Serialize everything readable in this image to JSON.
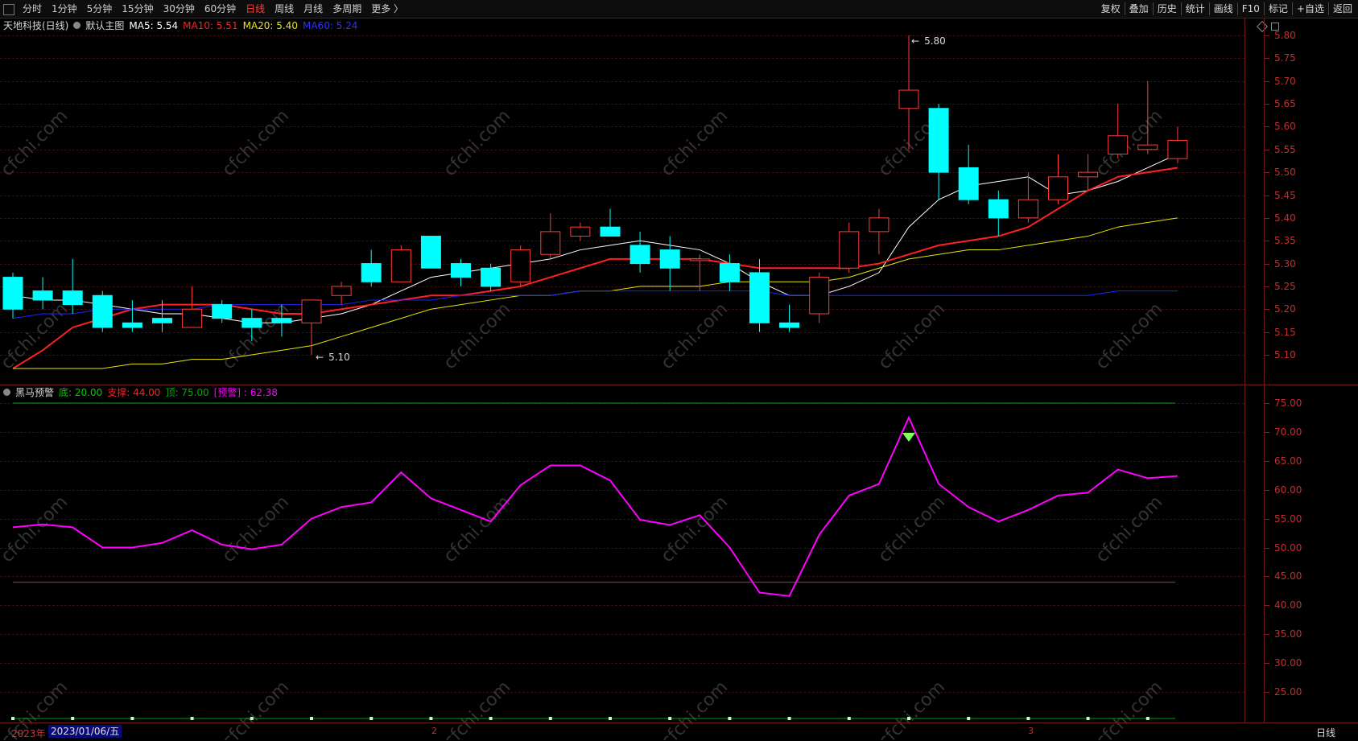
{
  "toolbar": {
    "periods": [
      "分时",
      "1分钟",
      "5分钟",
      "15分钟",
      "30分钟",
      "60分钟",
      "日线",
      "周线",
      "月线",
      "多周期",
      "更多 〉"
    ],
    "active_period": "日线",
    "tools": [
      "复权",
      "叠加",
      "历史",
      "统计",
      "画线",
      "F10",
      "标记",
      "+自选",
      "返回"
    ]
  },
  "main_legend": {
    "stock": "天地科技(日线)",
    "chart_name": "默认主图",
    "ma5": "MA5: 5.54",
    "ma10": "MA10: 5.51",
    "ma20": "MA20: 5.40",
    "ma60": "MA60: 5.24"
  },
  "sub_legend": {
    "name": "黑马预警",
    "bottom": "底: 20.00",
    "support": "支撑: 44.00",
    "top": "顶: 75.00",
    "warn": "[预警] : 62.38"
  },
  "colors": {
    "up": "#ff3b3b",
    "down": "#00ffff",
    "ma5": "#ffffff",
    "ma10": "#ff2020",
    "ma20": "#e8e800",
    "ma60": "#2020ff",
    "indicator": "#ff00ff"
  },
  "chart_data": [
    {
      "type": "candlestick",
      "title": "天地科技(日线)",
      "y_ticks": [
        "5.80",
        "5.75",
        "5.70",
        "5.65",
        "5.60",
        "5.55",
        "5.50",
        "5.45",
        "5.40",
        "5.35",
        "5.30",
        "5.25",
        "5.20",
        "5.15",
        "5.10"
      ],
      "ylim": [
        5.05,
        5.82
      ],
      "annotations": {
        "high": "5.80",
        "low": "5.10"
      },
      "candles": [
        {
          "o": 5.27,
          "h": 5.28,
          "l": 5.18,
          "c": 5.2
        },
        {
          "o": 5.24,
          "h": 5.27,
          "l": 5.2,
          "c": 5.22
        },
        {
          "o": 5.24,
          "h": 5.31,
          "l": 5.19,
          "c": 5.21
        },
        {
          "o": 5.23,
          "h": 5.24,
          "l": 5.15,
          "c": 5.16
        },
        {
          "o": 5.17,
          "h": 5.22,
          "l": 5.15,
          "c": 5.16
        },
        {
          "o": 5.18,
          "h": 5.22,
          "l": 5.15,
          "c": 5.17
        },
        {
          "o": 5.16,
          "h": 5.25,
          "l": 5.16,
          "c": 5.2
        },
        {
          "o": 5.21,
          "h": 5.22,
          "l": 5.17,
          "c": 5.18
        },
        {
          "o": 5.18,
          "h": 5.2,
          "l": 5.13,
          "c": 5.16
        },
        {
          "o": 5.18,
          "h": 5.21,
          "l": 5.14,
          "c": 5.17
        },
        {
          "o": 5.17,
          "h": 5.22,
          "l": 5.1,
          "c": 5.22
        },
        {
          "o": 5.23,
          "h": 5.26,
          "l": 5.21,
          "c": 5.25
        },
        {
          "o": 5.3,
          "h": 5.33,
          "l": 5.25,
          "c": 5.26
        },
        {
          "o": 5.26,
          "h": 5.34,
          "l": 5.26,
          "c": 5.33
        },
        {
          "o": 5.36,
          "h": 5.36,
          "l": 5.29,
          "c": 5.29
        },
        {
          "o": 5.3,
          "h": 5.31,
          "l": 5.25,
          "c": 5.27
        },
        {
          "o": 5.29,
          "h": 5.3,
          "l": 5.24,
          "c": 5.25
        },
        {
          "o": 5.26,
          "h": 5.34,
          "l": 5.25,
          "c": 5.33
        },
        {
          "o": 5.32,
          "h": 5.41,
          "l": 5.31,
          "c": 5.37
        },
        {
          "o": 5.36,
          "h": 5.39,
          "l": 5.35,
          "c": 5.38
        },
        {
          "o": 5.38,
          "h": 5.42,
          "l": 5.36,
          "c": 5.36
        },
        {
          "o": 5.34,
          "h": 5.37,
          "l": 5.28,
          "c": 5.3
        },
        {
          "o": 5.33,
          "h": 5.36,
          "l": 5.24,
          "c": 5.29
        },
        {
          "o": 5.31,
          "h": 5.32,
          "l": 5.24,
          "c": 5.31
        },
        {
          "o": 5.3,
          "h": 5.32,
          "l": 5.24,
          "c": 5.26
        },
        {
          "o": 5.28,
          "h": 5.31,
          "l": 5.15,
          "c": 5.17
        },
        {
          "o": 5.17,
          "h": 5.21,
          "l": 5.15,
          "c": 5.16
        },
        {
          "o": 5.19,
          "h": 5.28,
          "l": 5.17,
          "c": 5.27
        },
        {
          "o": 5.29,
          "h": 5.39,
          "l": 5.28,
          "c": 5.37
        },
        {
          "o": 5.37,
          "h": 5.42,
          "l": 5.32,
          "c": 5.4
        },
        {
          "o": 5.64,
          "h": 5.8,
          "l": 5.55,
          "c": 5.68
        },
        {
          "o": 5.64,
          "h": 5.65,
          "l": 5.44,
          "c": 5.5
        },
        {
          "o": 5.51,
          "h": 5.56,
          "l": 5.43,
          "c": 5.44
        },
        {
          "o": 5.44,
          "h": 5.46,
          "l": 5.36,
          "c": 5.4
        },
        {
          "o": 5.4,
          "h": 5.5,
          "l": 5.39,
          "c": 5.44
        },
        {
          "o": 5.44,
          "h": 5.54,
          "l": 5.43,
          "c": 5.49
        },
        {
          "o": 5.49,
          "h": 5.54,
          "l": 5.46,
          "c": 5.5
        },
        {
          "o": 5.54,
          "h": 5.65,
          "l": 5.53,
          "c": 5.58
        },
        {
          "o": 5.55,
          "h": 5.7,
          "l": 5.54,
          "c": 5.56
        },
        {
          "o": 5.53,
          "h": 5.6,
          "l": 5.52,
          "c": 5.57
        }
      ],
      "series": [
        {
          "name": "MA5",
          "values": [
            5.23,
            5.22,
            5.22,
            5.21,
            5.2,
            5.19,
            5.19,
            5.18,
            5.17,
            5.17,
            5.18,
            5.19,
            5.21,
            5.24,
            5.27,
            5.28,
            5.29,
            5.3,
            5.31,
            5.33,
            5.34,
            5.35,
            5.34,
            5.33,
            5.3,
            5.26,
            5.23,
            5.23,
            5.25,
            5.28,
            5.38,
            5.44,
            5.47,
            5.48,
            5.49,
            5.45,
            5.46,
            5.48,
            5.51,
            5.54
          ]
        },
        {
          "name": "MA10",
          "values": [
            5.07,
            5.11,
            5.16,
            5.18,
            5.2,
            5.21,
            5.21,
            5.21,
            5.2,
            5.19,
            5.19,
            5.2,
            5.21,
            5.22,
            5.23,
            5.23,
            5.24,
            5.25,
            5.27,
            5.29,
            5.31,
            5.31,
            5.31,
            5.31,
            5.3,
            5.29,
            5.29,
            5.29,
            5.29,
            5.3,
            5.32,
            5.34,
            5.35,
            5.36,
            5.38,
            5.42,
            5.46,
            5.49,
            5.5,
            5.51
          ]
        },
        {
          "name": "MA20",
          "values": [
            5.07,
            5.07,
            5.07,
            5.07,
            5.08,
            5.08,
            5.09,
            5.09,
            5.1,
            5.11,
            5.12,
            5.14,
            5.16,
            5.18,
            5.2,
            5.21,
            5.22,
            5.23,
            5.23,
            5.24,
            5.24,
            5.25,
            5.25,
            5.25,
            5.26,
            5.26,
            5.26,
            5.26,
            5.27,
            5.29,
            5.31,
            5.32,
            5.33,
            5.33,
            5.34,
            5.35,
            5.36,
            5.38,
            5.39,
            5.4
          ]
        },
        {
          "name": "MA60",
          "values": [
            5.18,
            5.19,
            5.19,
            5.2,
            5.2,
            5.2,
            5.2,
            5.21,
            5.21,
            5.21,
            5.21,
            5.21,
            5.22,
            5.22,
            5.22,
            5.23,
            5.23,
            5.23,
            5.23,
            5.24,
            5.24,
            5.24,
            5.24,
            5.24,
            5.24,
            5.24,
            5.23,
            5.23,
            5.23,
            5.23,
            5.23,
            5.23,
            5.23,
            5.23,
            5.23,
            5.23,
            5.23,
            5.24,
            5.24,
            5.24
          ]
        }
      ]
    },
    {
      "type": "line",
      "title": "黑马预警",
      "y_ticks": [
        "75.00",
        "70.00",
        "65.00",
        "60.00",
        "55.00",
        "50.00",
        "45.00",
        "40.00",
        "35.00",
        "30.00",
        "25.00"
      ],
      "ylim": [
        20,
        78
      ],
      "reference_lines": {
        "top": 75,
        "support": 44,
        "bottom": 20
      },
      "warn_marker_index": 30,
      "series": [
        {
          "name": "预警",
          "values": [
            53.5,
            54.0,
            53.5,
            50.0,
            50.0,
            50.8,
            53.0,
            50.5,
            49.7,
            50.5,
            55.0,
            57.0,
            57.8,
            63.0,
            58.5,
            56.5,
            54.5,
            60.8,
            64.2,
            64.2,
            61.6,
            54.8,
            53.9,
            55.6,
            50.0,
            42.2,
            41.6,
            52.2,
            59.0,
            61.0,
            72.5,
            61.0,
            57.0,
            54.5,
            56.5,
            59.0,
            59.5,
            63.5,
            62.0,
            62.38
          ]
        }
      ]
    }
  ],
  "bottom": {
    "year": "2023年",
    "selected_date": "2023/01/06/五",
    "month_ticks": [
      "2",
      "3"
    ],
    "period_label": "日线"
  },
  "watermark": "cfchi.com"
}
